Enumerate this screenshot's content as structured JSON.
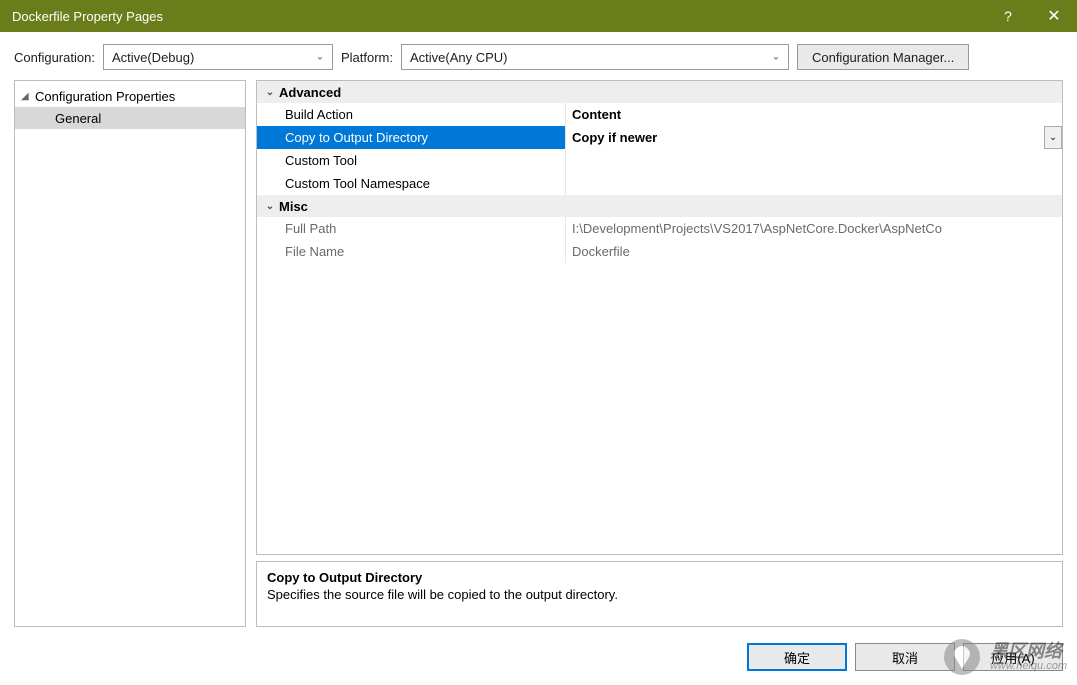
{
  "titlebar": {
    "title": "Dockerfile Property Pages"
  },
  "toolbar": {
    "config_label": "Configuration:",
    "config_value": "Active(Debug)",
    "platform_label": "Platform:",
    "platform_value": "Active(Any CPU)",
    "manager_label": "Configuration Manager..."
  },
  "tree": {
    "parent": "Configuration Properties",
    "child": "General"
  },
  "grid": {
    "cat1": "Advanced",
    "rows1": [
      {
        "key": "Build Action",
        "val": "Content",
        "bold": true
      },
      {
        "key": "Copy to Output Directory",
        "val": "Copy if newer",
        "selected": true
      },
      {
        "key": "Custom Tool",
        "val": ""
      },
      {
        "key": "Custom Tool Namespace",
        "val": ""
      }
    ],
    "cat2": "Misc",
    "rows2": [
      {
        "key": "Full Path",
        "val": "I:\\Development\\Projects\\VS2017\\AspNetCore.Docker\\AspNetCo"
      },
      {
        "key": "File Name",
        "val": "Dockerfile"
      }
    ]
  },
  "desc": {
    "title": "Copy to Output Directory",
    "body": "Specifies the source file will be copied to the output directory."
  },
  "footer": {
    "ok": "确定",
    "cancel": "取消",
    "apply": "应用(A)"
  },
  "watermark": {
    "main": "黑区网络",
    "sub": "www.heiqu.com"
  }
}
